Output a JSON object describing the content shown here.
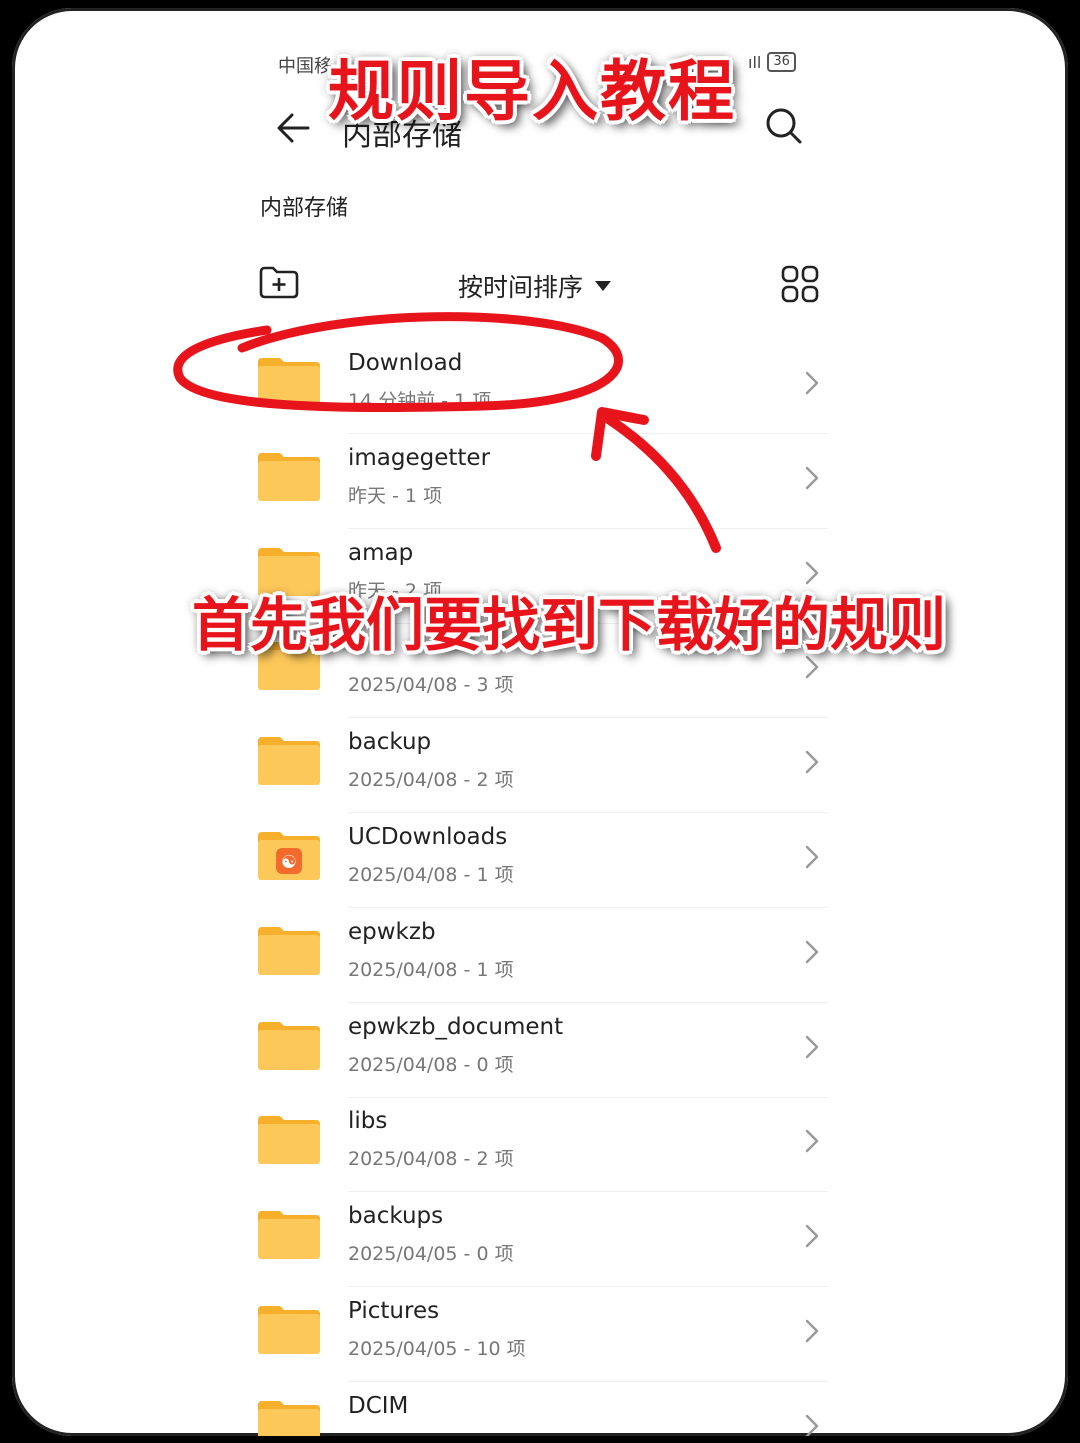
{
  "status": {
    "carrier": "中国移",
    "signal": "ıll",
    "battery": "36"
  },
  "header": {
    "title": "内部存储"
  },
  "breadcrumb": "内部存储",
  "toolbar": {
    "sort_label": "按时间排序"
  },
  "files": [
    {
      "name": "Download",
      "meta": "14 分钟前 - 1 项",
      "icon": "folder-icon"
    },
    {
      "name": "imagegetter",
      "meta": "昨天 - 1 项",
      "icon": "folder-icon"
    },
    {
      "name": "amap",
      "meta": "昨天 - 2 项",
      "icon": "folder-icon"
    },
    {
      "name": "",
      "meta": "2025/04/08 - 3 项",
      "icon": "folder-icon"
    },
    {
      "name": "backup",
      "meta": "2025/04/08 - 2 项",
      "icon": "folder-icon"
    },
    {
      "name": "UCDownloads",
      "meta": "2025/04/08 - 1 项",
      "icon": "uc-folder-icon"
    },
    {
      "name": "epwkzb",
      "meta": "2025/04/08 - 1 项",
      "icon": "folder-icon"
    },
    {
      "name": "epwkzb_document",
      "meta": "2025/04/08 - 0 项",
      "icon": "folder-icon"
    },
    {
      "name": "libs",
      "meta": "2025/04/08 - 2 项",
      "icon": "folder-icon"
    },
    {
      "name": "backups",
      "meta": "2025/04/05 - 0 项",
      "icon": "folder-icon"
    },
    {
      "name": "Pictures",
      "meta": "2025/04/05 - 10 项",
      "icon": "folder-icon"
    },
    {
      "name": "DCIM",
      "meta": "",
      "icon": "folder-icon"
    }
  ],
  "overlay": {
    "title": "规则导入教程",
    "caption": "首先我们要找到下载好的规则"
  },
  "colors": {
    "folder": "#fdc85a",
    "folder_tab": "#f7b02c",
    "annotation": "#e8141c"
  }
}
